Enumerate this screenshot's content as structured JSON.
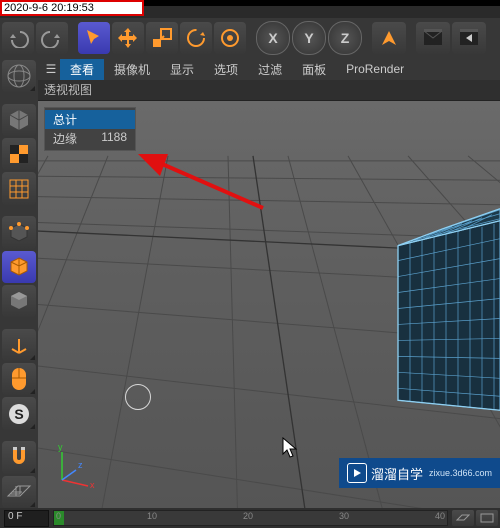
{
  "timestamp": "2020-9-6 20:19:53",
  "top_toolbar": {
    "undo": "undo",
    "redo": "redo",
    "select": "select",
    "move": "move",
    "scale": "scale",
    "rotate": "rotate",
    "lasttool": "lasttool",
    "axis_x": "X",
    "axis_y": "Y",
    "axis_z": "Z",
    "coord": "coord",
    "clapper": "clapper",
    "render": "render"
  },
  "menu": {
    "view": "查看",
    "camera": "摄像机",
    "display": "显示",
    "options": "选项",
    "filter": "过滤",
    "panel": "面板",
    "prorender": "ProRender"
  },
  "viewport_title": "透视视图",
  "hud": {
    "total_label": "总计",
    "edges_label": "边缘",
    "edges_value": "1188"
  },
  "gizmo": {
    "x": "x",
    "y": "y",
    "z": "z"
  },
  "timeline": {
    "start": "0 F",
    "marks": [
      "0",
      "10",
      "20",
      "30",
      "40"
    ]
  },
  "watermark": {
    "brand": "溜溜自学",
    "url": "zixue.3d66.com"
  },
  "left_tools": {
    "globe": "globe-icon",
    "cube": "object-mode-icon",
    "checker": "texture-icon",
    "grid": "uv-grid-icon",
    "vertex": "vertex-mode-icon",
    "edge": "edge-mode-icon",
    "face": "face-mode-icon",
    "axes": "axis-icon",
    "mouse": "mouse-icon",
    "s": "snap-icon",
    "magnet": "magnet-icon",
    "hatch": "workplane-icon"
  }
}
